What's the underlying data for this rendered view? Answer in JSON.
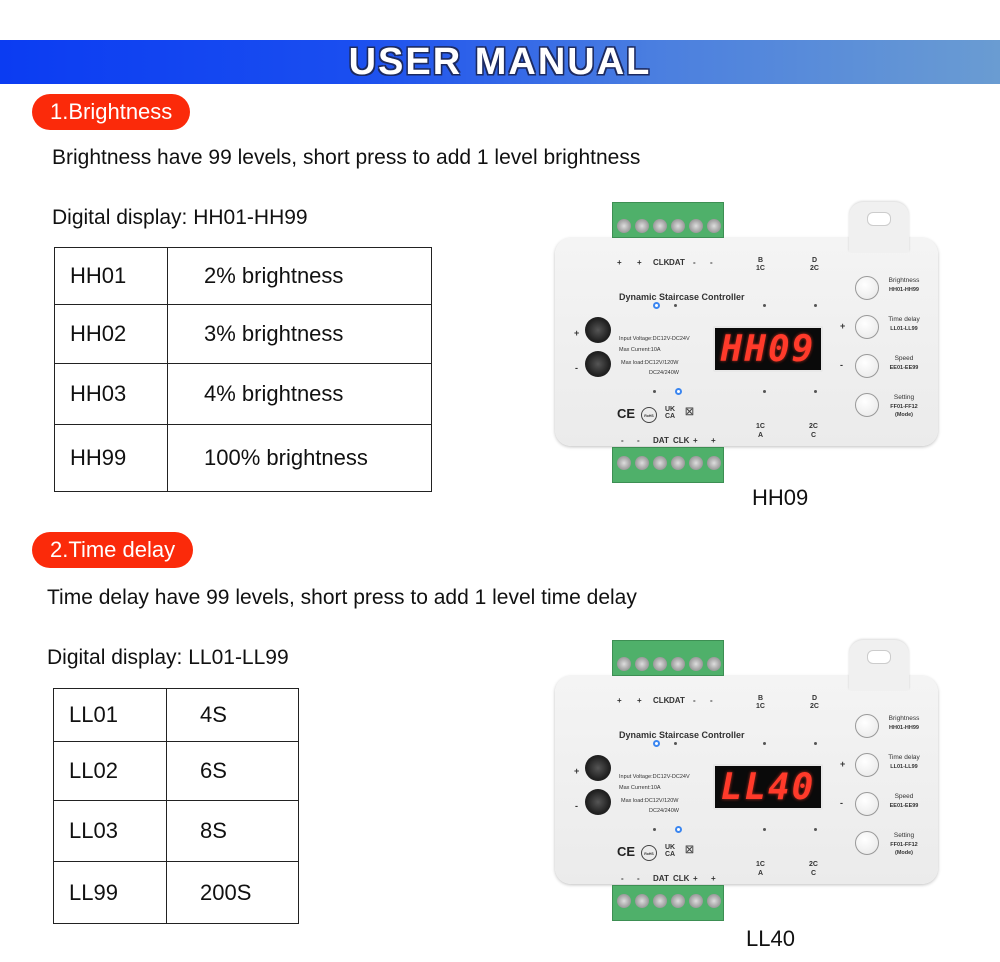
{
  "banner": {
    "title": "USER MANUAL"
  },
  "sections": [
    {
      "heading": "1.Brightness",
      "description": "Brightness have 99 levels, short press to add 1 level brightness",
      "display_range": "Digital display: HH01-HH99",
      "table": [
        [
          "HH01",
          "2% brightness"
        ],
        [
          "HH02",
          "3% brightness"
        ],
        [
          "HH03",
          "4% brightness"
        ],
        [
          "HH99",
          "100% brightness"
        ]
      ],
      "device_display": "HH09",
      "caption": "HH09"
    },
    {
      "heading": "2.Time delay",
      "description": "Time delay have 99 levels, short press to add 1 level time delay",
      "display_range": "Digital display: LL01-LL99",
      "table": [
        [
          "LL01",
          "4S"
        ],
        [
          "LL02",
          "6S"
        ],
        [
          "LL03",
          "8S"
        ],
        [
          "LL99",
          "200S"
        ]
      ],
      "device_display": "LL40",
      "caption": "LL40"
    }
  ],
  "device": {
    "title": "Dynamic Staircase Controller",
    "top_terminal_labels": [
      "+",
      "+",
      "CLK",
      "DAT",
      "-",
      "-"
    ],
    "top_port_labels": [
      [
        "B",
        "1C"
      ],
      [
        "D",
        "2C"
      ]
    ],
    "bottom_terminal_labels": [
      "-",
      "-",
      "DAT",
      "CLK",
      "+",
      "+"
    ],
    "bottom_port_labels": [
      [
        "1C",
        "A"
      ],
      [
        "2C",
        "C"
      ]
    ],
    "power_plus": "+",
    "power_minus": "-",
    "specs": [
      "Input Voltage:DC12V-DC24V",
      "Max Current:10A",
      "Max load:DC12V/120W",
      "DC24/240W"
    ],
    "certifications": [
      "CE",
      "RoHS",
      "UK CA",
      "WEEE"
    ],
    "buttons": [
      {
        "label": "Brightness",
        "range": "HH01-HH99",
        "side": ""
      },
      {
        "label": "Time delay",
        "range": "LL01-LL99",
        "side": "+"
      },
      {
        "label": "Speed",
        "range": "EE01-EE99",
        "side": "-"
      },
      {
        "label": "Setting",
        "range": "FF01-FF12",
        "extra": "(Mode)",
        "side": ""
      }
    ]
  },
  "colors": {
    "banner_start": "#0b3cf2",
    "banner_end": "#6a9cd2",
    "pill": "#fb2a0a",
    "display_digits": "#ff3a2a",
    "terminal": "#4fb06a"
  }
}
